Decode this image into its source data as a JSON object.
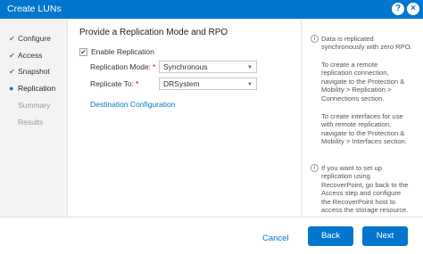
{
  "window": {
    "title": "Create LUNs"
  },
  "steps": [
    {
      "label": "Configure",
      "state": "done"
    },
    {
      "label": "Access",
      "state": "done"
    },
    {
      "label": "Snapshot",
      "state": "done"
    },
    {
      "label": "Replication",
      "state": "current"
    },
    {
      "label": "Summary",
      "state": "pending"
    },
    {
      "label": "Results",
      "state": "pending"
    }
  ],
  "main": {
    "heading": "Provide a Replication Mode and RPO",
    "enable_replication": {
      "label": "Enable Replication",
      "checked": true
    },
    "replication_mode": {
      "label": "Replication Mode:",
      "value": "Synchronous"
    },
    "replicate_to": {
      "label": "Replicate To:",
      "value": "DRSystem"
    },
    "destination_link": "Destination Configuration"
  },
  "info": {
    "p1": "Data is replicated\nsynchronously with zero RPO.",
    "p2": "To create a remote\nreplication connection,\nnavigate to the Protection &\nMobility > Replication >\nConnections section.",
    "p3": "To create interfaces for use\nwith remote replication,\nnavigate to the Protection &\nMobility > Interfaces section.",
    "p4": "If you want to set up\nreplication using\nRecoverPoint, go back to the\nAccess step and configure\nthe RecoverPoint host to\naccess the storage resource."
  },
  "footer": {
    "cancel": "Cancel",
    "back": "Back",
    "next": "Next"
  },
  "icons": {
    "help": "?",
    "close": "×",
    "check": "✔",
    "current": "●",
    "info": "i",
    "caret": "▼"
  },
  "colors": {
    "brand": "#0076ce",
    "done": "#3a9a3a",
    "required": "#d0021b"
  }
}
